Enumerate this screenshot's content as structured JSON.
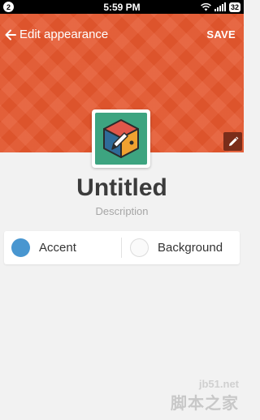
{
  "status_bar": {
    "notification_badge": "2",
    "time": "5:59 PM",
    "battery": "32"
  },
  "header": {
    "title": "Edit appearance",
    "save_label": "SAVE",
    "background_color": "#e5572e",
    "icons": {
      "back": "arrow-left-icon",
      "edit": "pencil-icon"
    }
  },
  "app": {
    "name": "Untitled",
    "description": "Description",
    "icon": "cube-pencil-icon",
    "icon_background": "#3da480"
  },
  "colors": {
    "accent_label": "Accent",
    "accent_color": "#4896d0",
    "background_label": "Background",
    "background_color": "#fafafa"
  },
  "watermark": {
    "domain": "jb51.net",
    "brand": "脚本之家"
  }
}
